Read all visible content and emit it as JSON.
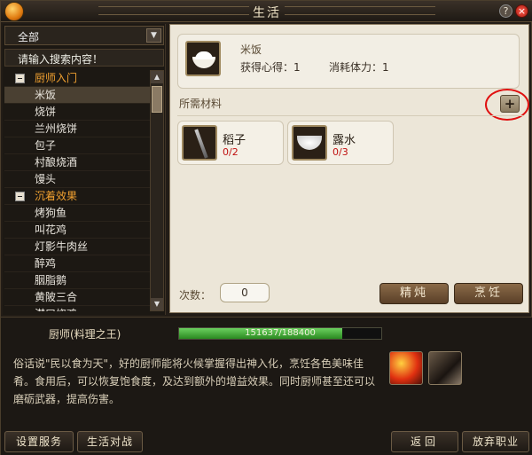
{
  "window": {
    "title": "生活"
  },
  "filter": {
    "selected": "全部",
    "search_placeholder": "请输入搜索内容！"
  },
  "tree": {
    "categories": [
      {
        "label": "厨师入门",
        "items": [
          "米饭",
          "烧饼",
          "兰州烧饼",
          "包子",
          "村酿烧酒",
          "馒头"
        ]
      },
      {
        "label": "沉着效果",
        "items": [
          "烤狗鱼",
          "叫花鸡",
          "灯影牛肉丝",
          "醉鸡",
          "胭脂鹅",
          "黄陂三合",
          "潜口烧鸡"
        ]
      }
    ],
    "selected_item": "米饭"
  },
  "recipe": {
    "name": "米饭",
    "gain": "获得心得：1",
    "cost": "消耗体力：1"
  },
  "materials": {
    "label": "所需材料",
    "items": [
      {
        "name": "稻子",
        "count": "0/2",
        "icon": "rice-stalk-icon"
      },
      {
        "name": "露水",
        "count": "0/3",
        "icon": "water-bowl-icon"
      }
    ]
  },
  "craft": {
    "count_label": "次数：",
    "count_value": "0",
    "refine_label": "精炖",
    "cook_label": "烹饪"
  },
  "profession": {
    "title": "厨师(料理之王)",
    "progress_text": "151637/188400",
    "progress_fraction": 0.805,
    "description": "俗话说\"民以食为天\"，好的厨师能将火候掌握得出神入化，烹饪各色美味佳肴。食用后，可以恢复饱食度，及达到额外的增益效果。同时厨师甚至还可以磨砺武器，提高伤害。"
  },
  "buttons": {
    "service": "设置服务",
    "battle": "生活对战",
    "back": "返回",
    "quit": "放弃职业"
  },
  "colors": {
    "category": "#f0a030",
    "annotation": "#e01010",
    "progress": "#4ab040"
  }
}
